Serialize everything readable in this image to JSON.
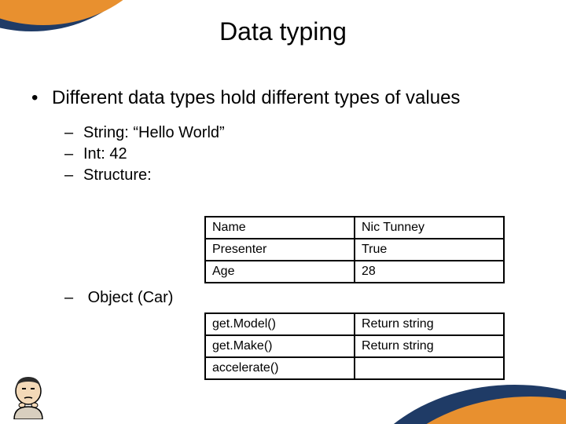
{
  "title": "Data typing",
  "main_bullet": "Different data types hold different types of values",
  "sub_bullets": {
    "b1": "String: “Hello World”",
    "b2": "Int: 42",
    "b3": "Structure:"
  },
  "object_bullet": "Object (Car)",
  "table_struct": {
    "r1c1": "Name",
    "r1c2": "Nic Tunney",
    "r2c1": "Presenter",
    "r2c2": "True",
    "r3c1": "Age",
    "r3c2": "28"
  },
  "table_obj": {
    "r1c1": "get.Model()",
    "r1c2": "Return string",
    "r2c1": "get.Make()",
    "r2c2": "Return string",
    "r3c1": "accelerate()",
    "r3c2": ""
  }
}
